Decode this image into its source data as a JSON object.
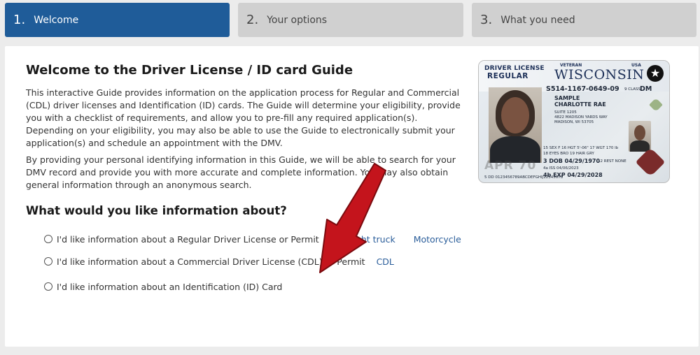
{
  "steps": [
    {
      "num": "1.",
      "label": "Welcome",
      "active": true
    },
    {
      "num": "2.",
      "label": "Your options",
      "active": false
    },
    {
      "num": "3.",
      "label": "What you need",
      "active": false
    }
  ],
  "main": {
    "title": "Welcome to the Driver License / ID card Guide",
    "para1": "This interactive Guide provides information on the application process for Regular and Commercial (CDL) driver licenses and Identification (ID) cards. The Guide will determine your eligibility, provide you with a checklist of requirements, and allow you to pre-fill any required application(s). Depending on your eligibility, you may also be able to use the Guide to electronically submit your application(s) and schedule an appointment with the DMV.",
    "para2": "By providing your personal identifying information in this Guide, we will be able to search for your DMV record and provide you with more accurate and complete information. You may also obtain general information through an anonymous search.",
    "subtitle": "What would you like information about?",
    "options": [
      {
        "label": "I'd like information about a Regular Driver License or Permit",
        "links": [
          "Car/Light truck",
          "Motorcycle"
        ]
      },
      {
        "label": "I'd like information about a Commercial Driver License (CDL) or Permit",
        "links": [
          "CDL"
        ]
      },
      {
        "label": "I'd like information about an Identification (ID) Card",
        "links": []
      }
    ]
  },
  "license": {
    "header": "DRIVER LICENSE",
    "class_type": "REGULAR",
    "veteran": "VETERAN",
    "usa": "USA",
    "state": "WISCONSIN",
    "number": "S514-1167-0649-09",
    "class_label": "9 CLASS",
    "class_value": "DM",
    "last_name": "SAMPLE",
    "first_name": "CHARLOTTE RAE",
    "address1": "SUITE 1205",
    "address2": "4822 MADISON YARDS WAY",
    "address3": "MADISON, WI 53705",
    "sex_ht_wt": "15 SEX F  16 HGT 5'-06\"  17 WGT 170 lb",
    "eyes_hair": "18 EYES BRO  19 HAIR GRY",
    "dob": "3 DOB 04/29/1970",
    "rest": "12 REST NONE",
    "iss": "4a ISS 04/06/2023",
    "exp": "4b EXP 04/29/2028",
    "ghost": "APR 70",
    "dd": "5 DD 0123456789ABCDEFGHIJ12345678"
  },
  "colors": {
    "active_step": "#1f5c99",
    "inactive_step": "#d0d0d0",
    "link": "#2a5d9a",
    "arrow": "#c4141c"
  }
}
